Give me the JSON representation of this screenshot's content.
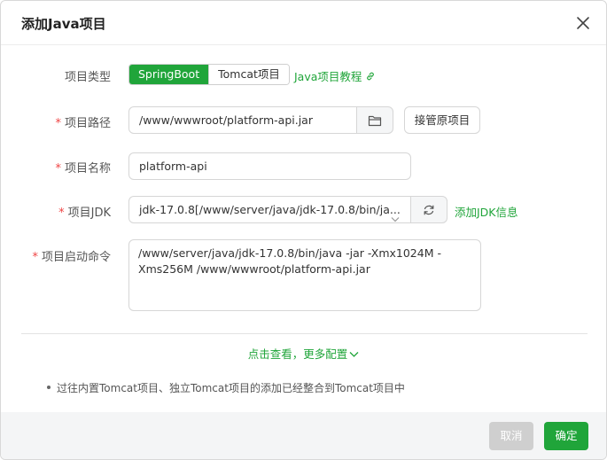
{
  "dialog": {
    "title": "添加Java项目"
  },
  "form": {
    "project_type": {
      "label": "项目类型",
      "options": [
        "SpringBoot",
        "Tomcat项目"
      ],
      "selected": "SpringBoot",
      "tutorial_link": "Java项目教程"
    },
    "project_path": {
      "label": "项目路径",
      "value": "/www/wwwroot/platform-api.jar",
      "takeover_button": "接管原项目"
    },
    "project_name": {
      "label": "项目名称",
      "value": "platform-api"
    },
    "project_jdk": {
      "label": "项目JDK",
      "value": "jdk-17.0.8[/www/server/java/jdk-17.0.8/bin/ja...",
      "add_link": "添加JDK信息"
    },
    "start_command": {
      "label": "项目启动命令",
      "value": "/www/server/java/jdk-17.0.8/bin/java -jar  -Xmx1024M -Xms256M /www/wwwroot/platform-api.jar"
    }
  },
  "more_config": "点击查看，更多配置",
  "note": "过往内置Tomcat项目、独立Tomcat项目的添加已经整合到Tomcat项目中",
  "footer": {
    "cancel": "取消",
    "confirm": "确定"
  },
  "icons": {
    "close": "close-icon",
    "folder": "folder-icon",
    "refresh": "refresh-icon",
    "caret": "chevron-down-icon",
    "link": "link-icon"
  },
  "colors": {
    "accent": "#20a53a",
    "required": "#ef4444",
    "cancel_bg": "#cfcfcf"
  }
}
